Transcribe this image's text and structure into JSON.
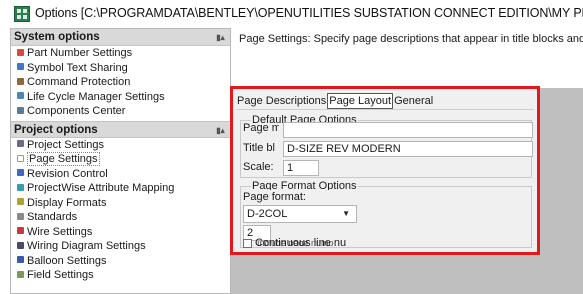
{
  "window": {
    "title": "Options [C:\\PROGRAMDATA\\BENTLEY\\OPENUTILITIES SUBSTATION CONNECT EDITION\\MY PROJECTS\\SU",
    "icon": "app-grid-icon"
  },
  "sidebar": {
    "system": {
      "header": "System options",
      "items": [
        {
          "label": "Part Number Settings",
          "icon": "part-number-icon",
          "color": "#d94a3a"
        },
        {
          "label": "Symbol Text Sharing",
          "icon": "symbol-text-icon",
          "color": "#3a78c9"
        },
        {
          "label": "Command Protection",
          "icon": "command-protection-icon",
          "color": "#8a6a3a"
        },
        {
          "label": "Life Cycle Manager Settings",
          "icon": "lifecycle-icon",
          "color": "#4a8ab0"
        },
        {
          "label": "Components Center",
          "icon": "components-center-icon",
          "color": "#5a7a9a"
        }
      ]
    },
    "project": {
      "header": "Project options",
      "items": [
        {
          "label": "Project Settings",
          "icon": "project-settings-icon",
          "color": "#6a6a8a"
        },
        {
          "label": "Page Settings",
          "icon": "page-settings-icon",
          "color": "#ffffff"
        },
        {
          "label": "Revision Control",
          "icon": "revision-control-icon",
          "color": "#3a6ac9"
        },
        {
          "label": "ProjectWise Attribute Mapping",
          "icon": "projectwise-icon",
          "color": "#3a9ab0"
        },
        {
          "label": "Display Formats",
          "icon": "display-formats-icon",
          "color": "#b0a03a"
        },
        {
          "label": "Standards",
          "icon": "standards-icon",
          "color": "#8a8a8a"
        },
        {
          "label": "Wire Settings",
          "icon": "wire-settings-icon",
          "color": "#c93a3a"
        },
        {
          "label": "Wiring Diagram Settings",
          "icon": "wiring-diagram-icon",
          "color": "#4a4a6a"
        },
        {
          "label": "Balloon Settings",
          "icon": "balloon-settings-icon",
          "color": "#3a5ab0"
        },
        {
          "label": "Field Settings",
          "icon": "field-settings-icon",
          "color": "#7a9a5a"
        }
      ]
    }
  },
  "main": {
    "description": "Page Settings: Specify page descriptions that appear in title blocks and",
    "tabs": [
      "Page Descriptions",
      "Page Layout",
      "General"
    ],
    "active_tab": 1,
    "default_group": {
      "title": "Default Page Options",
      "page_label": "Page m",
      "title_block_label": "Title bl",
      "title_block_value": "D-SIZE REV MODERN",
      "scale_label": "Scale:",
      "scale_value": "1"
    },
    "format_group": {
      "title": "Page Format Options",
      "page_format_label": "Page format:",
      "page_format_value": "D-2COL",
      "number_value": "2",
      "include_label": "Include page numb",
      "continuous_label": "Continuous line nu"
    }
  },
  "colors": {
    "highlight_frame": "#e0191f",
    "panel_header": "#d9d9d9",
    "dialog_bg": "#f0f0f0",
    "backdrop": "#bfbfbf"
  }
}
